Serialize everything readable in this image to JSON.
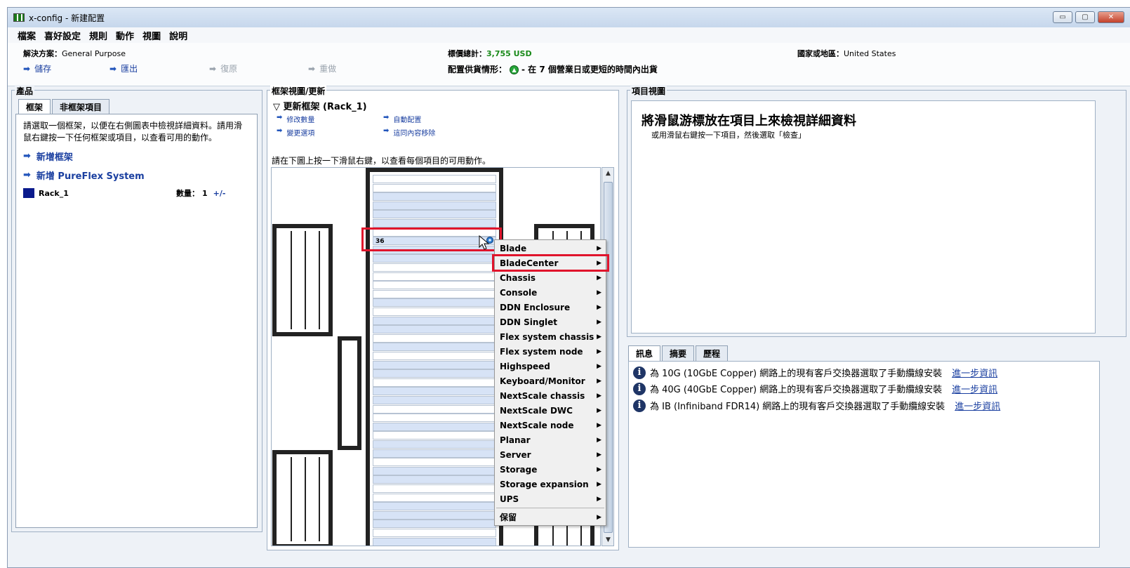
{
  "window": {
    "title": "x-config - 新建配置",
    "controls": [
      "▭",
      "▢",
      "✕"
    ]
  },
  "menu": [
    "檔案",
    "喜好設定",
    "規則",
    "動作",
    "視圖",
    "說明"
  ],
  "info": {
    "solution_label": "解決方案：",
    "solution_value": "General Purpose",
    "price_label": "標價總計：",
    "price_value": "3,755 USD",
    "country_label": "國家或地區：",
    "country_value": "United States",
    "shipping_label": "配置供貨情形：",
    "shipping_text": "- 在 7 個營業日或更短的時間內出貨",
    "actions": [
      {
        "label": "儲存",
        "enabled": true
      },
      {
        "label": "匯出",
        "enabled": true
      },
      {
        "label": "復原",
        "enabled": false
      },
      {
        "label": "重做",
        "enabled": false
      }
    ]
  },
  "products": {
    "title": "產品",
    "tabs": [
      "框架",
      "非框架項目"
    ],
    "description": "請選取一個框架，以便在右側圖表中檢視詳細資料。請用滑鼠右鍵按一下任何框架或項目，以查看可用的動作。",
    "add_rack": "新增框架",
    "add_pureflex": "新增 PureFlex System",
    "rack_name": "Rack_1",
    "qty_label": "數量：",
    "qty_value": "1",
    "qty_adjust": "+/-"
  },
  "rack_view": {
    "title": "框架視圖/更新",
    "section": "▽ 更新框架 (Rack_1)",
    "actions": [
      "修改數量",
      "自動配置",
      "變更選項",
      "這同內容移除"
    ],
    "hint": "請在下圖上按一下滑鼠右鍵，以查看每個項目的可用動作。",
    "slot_number": "36"
  },
  "context_menu": {
    "items": [
      "Blade",
      "BladeCenter",
      "Chassis",
      "Console",
      "DDN Enclosure",
      "DDN Singlet",
      "Flex system chassis",
      "Flex system node",
      "Highspeed",
      "Keyboard/Monitor",
      "NextScale chassis",
      "NextScale DWC",
      "NextScale node",
      "Planar",
      "Server",
      "Storage",
      "Storage expansion",
      "UPS"
    ],
    "reserved": "保留",
    "highlighted": "BladeCenter"
  },
  "item_view": {
    "title": "項目視圖",
    "heading": "將滑鼠游標放在項目上來檢視詳細資料",
    "subtext": "或用滑鼠右鍵按一下項目，然後選取「檢查」"
  },
  "messages": {
    "tabs": [
      "訊息",
      "摘要",
      "歷程"
    ],
    "rows": [
      {
        "text": "為 10G (10GbE Copper) 網路上的現有客戶交換器選取了手動纜線安裝",
        "link": "進一步資訊"
      },
      {
        "text": "為 40G (40GbE Copper) 網路上的現有客戶交換器選取了手動纜線安裝",
        "link": "進一步資訊"
      },
      {
        "text": "為 IB (Infiniband FDR14) 網路上的現有客戶交換器選取了手動纜線安裝",
        "link": "進一步資訊"
      }
    ]
  },
  "colors": {
    "accent": "#1a3fa0",
    "highlight_border": "#e0142c",
    "slot_fill": "#d7e3f6",
    "rack_swatch": "#0a1a8c"
  }
}
